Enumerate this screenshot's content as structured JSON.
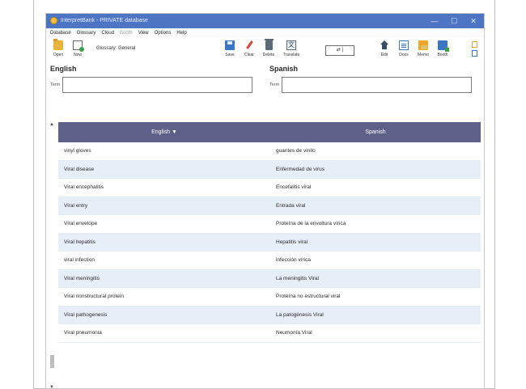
{
  "window": {
    "title": "InterpretBank - PRIVATE database",
    "controls": {
      "minimize": "—",
      "maximize": "☐",
      "close": "✕"
    }
  },
  "menubar": {
    "items": [
      {
        "label": "Database",
        "disabled": false
      },
      {
        "label": "Glossary",
        "disabled": false
      },
      {
        "label": "Cloud",
        "disabled": false
      },
      {
        "label": "Booth",
        "disabled": true
      },
      {
        "label": "View",
        "disabled": false
      },
      {
        "label": "Options",
        "disabled": false
      },
      {
        "label": "Help",
        "disabled": false
      }
    ]
  },
  "toolbar": {
    "open_label": "Open",
    "new_label": "New",
    "glossary_label": "Glossary: General",
    "save_label": "Save",
    "clear_label": "Clear",
    "delete_label": "Delete",
    "translate_label": "Translate",
    "zoom_value": "⇄ |",
    "edit_label": "Edit",
    "docs_label": "Docs",
    "memo_label": "Memo",
    "booth_label": "Booth"
  },
  "languages": {
    "left": {
      "name": "English",
      "term_label": "Term",
      "term_value": ""
    },
    "right": {
      "name": "Spanish",
      "term_label": "Term",
      "term_value": ""
    }
  },
  "table": {
    "headers": {
      "english": "English ▼",
      "spanish": "Spanish"
    },
    "rows": [
      {
        "en": "vinyl gloves",
        "es": "guantes de vinilo"
      },
      {
        "en": "Viral disease",
        "es": "Enfermedad de virus"
      },
      {
        "en": "Viral encephalitis",
        "es": "Encefalitis viral"
      },
      {
        "en": "Viral entry",
        "es": "Entrada viral"
      },
      {
        "en": "Viral envelope",
        "es": "Proteína de la envoltura vírica"
      },
      {
        "en": "Viral hepatitis",
        "es": "Hepatitis viral"
      },
      {
        "en": "viral infection",
        "es": "infección vírica"
      },
      {
        "en": "Viral meningitis",
        "es": "La meningitis Viral"
      },
      {
        "en": "Viral nonstructural protein",
        "es": "Proteína no estructural viral"
      },
      {
        "en": "Viral pathogenesis",
        "es": "La patogénesis Viral"
      },
      {
        "en": "Viral pneumonia",
        "es": "Neumonía Viral"
      }
    ]
  },
  "colors": {
    "titlebar": "#4e74c4",
    "table_header": "#5d6187",
    "row_alt": "#e6eef8"
  }
}
